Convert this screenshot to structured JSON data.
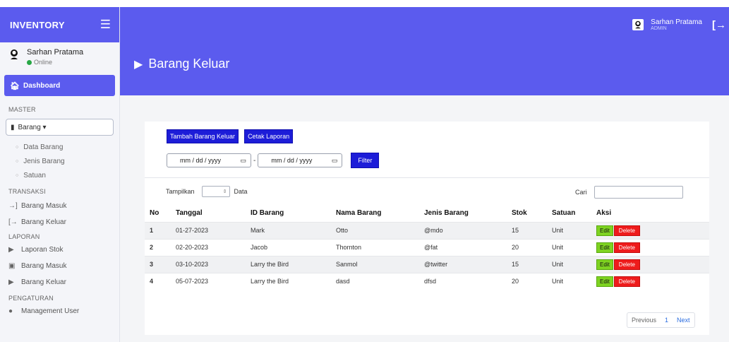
{
  "brand": {
    "title": "INVENTORY",
    "menu_icon": "☰"
  },
  "user": {
    "name": "Sarhan Pratama",
    "status": "Online",
    "role": "ADMIN"
  },
  "sidebar": {
    "dashboard_label": "Dashboard",
    "section_master": "MASTER",
    "barang_label": "Barang ▾",
    "master_items": [
      "Data Barang",
      "Jenis Barang",
      "Satuan"
    ],
    "section_transaksi": "TRANSAKSI",
    "transaksi_items": [
      "Barang Masuk",
      "Barang Keluar"
    ],
    "section_laporan": "LAPORAN",
    "laporan_items": [
      "Laporan Stok",
      "Barang Masuk",
      "Barang Keluar"
    ],
    "section_pengaturan": "PENGATURAN",
    "pengaturan_items": [
      "Management User"
    ]
  },
  "page": {
    "title": "Barang Keluar"
  },
  "actions": {
    "add_label": "Tambah Barang Keluar",
    "print_label": "Cetak Laporan",
    "filter_label": "Filter"
  },
  "filter": {
    "date_from": "mm / dd / yyyy",
    "date_to": "mm / dd / yyyy",
    "separator": "-"
  },
  "table_controls": {
    "show_label": "Tampilkan",
    "show_suffix": "Data",
    "search_label": "Cari"
  },
  "table": {
    "headers": [
      "No",
      "Tanggal",
      "ID Barang",
      "Nama Barang",
      "Jenis Barang",
      "Stok",
      "Satuan",
      "Aksi"
    ],
    "rows": [
      [
        "1",
        "01-27-2023",
        "Mark",
        "Otto",
        "@mdo",
        "15",
        "Unit"
      ],
      [
        "2",
        "02-20-2023",
        "Jacob",
        "Thornton",
        "@fat",
        "20",
        "Unit"
      ],
      [
        "3",
        "03-10-2023",
        "Larry the Bird",
        "Sanmol",
        "@twitter",
        "15",
        "Unit"
      ],
      [
        "4",
        "05-07-2023",
        "Larry the Bird",
        "dasd",
        "dfsd",
        "20",
        "Unit"
      ]
    ],
    "edit_label": "Edit",
    "delete_label": "Delete"
  },
  "pagination": {
    "prev": "Previous",
    "current": "1",
    "next": "Next"
  },
  "colors": {
    "primary": "#5b5bee",
    "button": "#1d1dd8",
    "edit": "#7ed321",
    "delete": "#ee1c1c",
    "online": "#28a745"
  }
}
